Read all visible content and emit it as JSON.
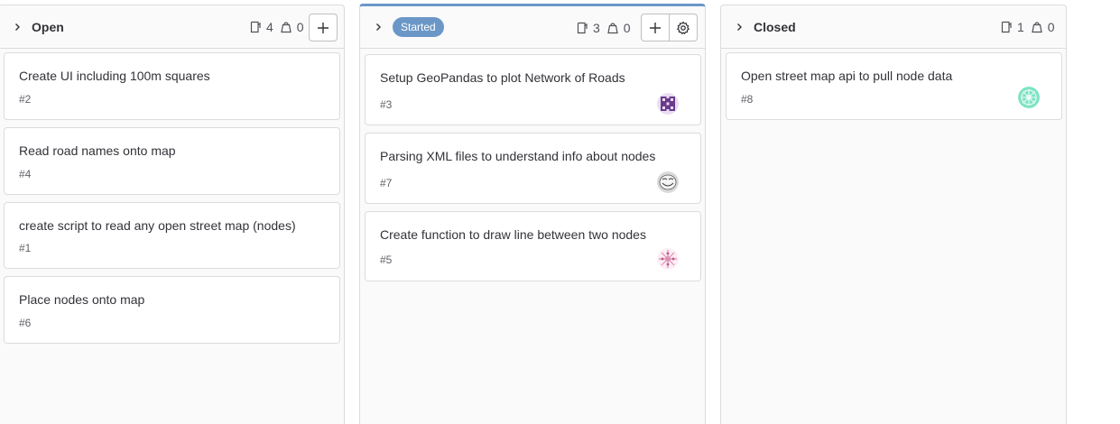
{
  "columns": [
    {
      "title": "Open",
      "issue_count": "4",
      "weight_count": "0",
      "cards": [
        {
          "title": "Create UI including 100m squares",
          "number": "#2"
        },
        {
          "title": "Read road names onto map",
          "number": "#4"
        },
        {
          "title": "create script to read any open street map (nodes)",
          "number": "#1"
        },
        {
          "title": "Place nodes onto map",
          "number": "#6"
        }
      ]
    },
    {
      "title": "Started",
      "label_color": "#6b97c8",
      "issue_count": "3",
      "weight_count": "0",
      "cards": [
        {
          "title": "Setup GeoPandas to plot Network of Roads",
          "number": "#3",
          "avatar": "purple-pattern-avatar"
        },
        {
          "title": "Parsing XML files to understand info about nodes",
          "number": "#7",
          "avatar": "troll-face-avatar"
        },
        {
          "title": "Create function to draw line between two nodes",
          "number": "#5",
          "avatar": "pink-pattern-avatar"
        }
      ]
    },
    {
      "title": "Closed",
      "issue_count": "1",
      "weight_count": "0",
      "cards": [
        {
          "title": "Open street map api to pull node data",
          "number": "#8",
          "avatar": "green-pattern-avatar"
        }
      ]
    }
  ]
}
